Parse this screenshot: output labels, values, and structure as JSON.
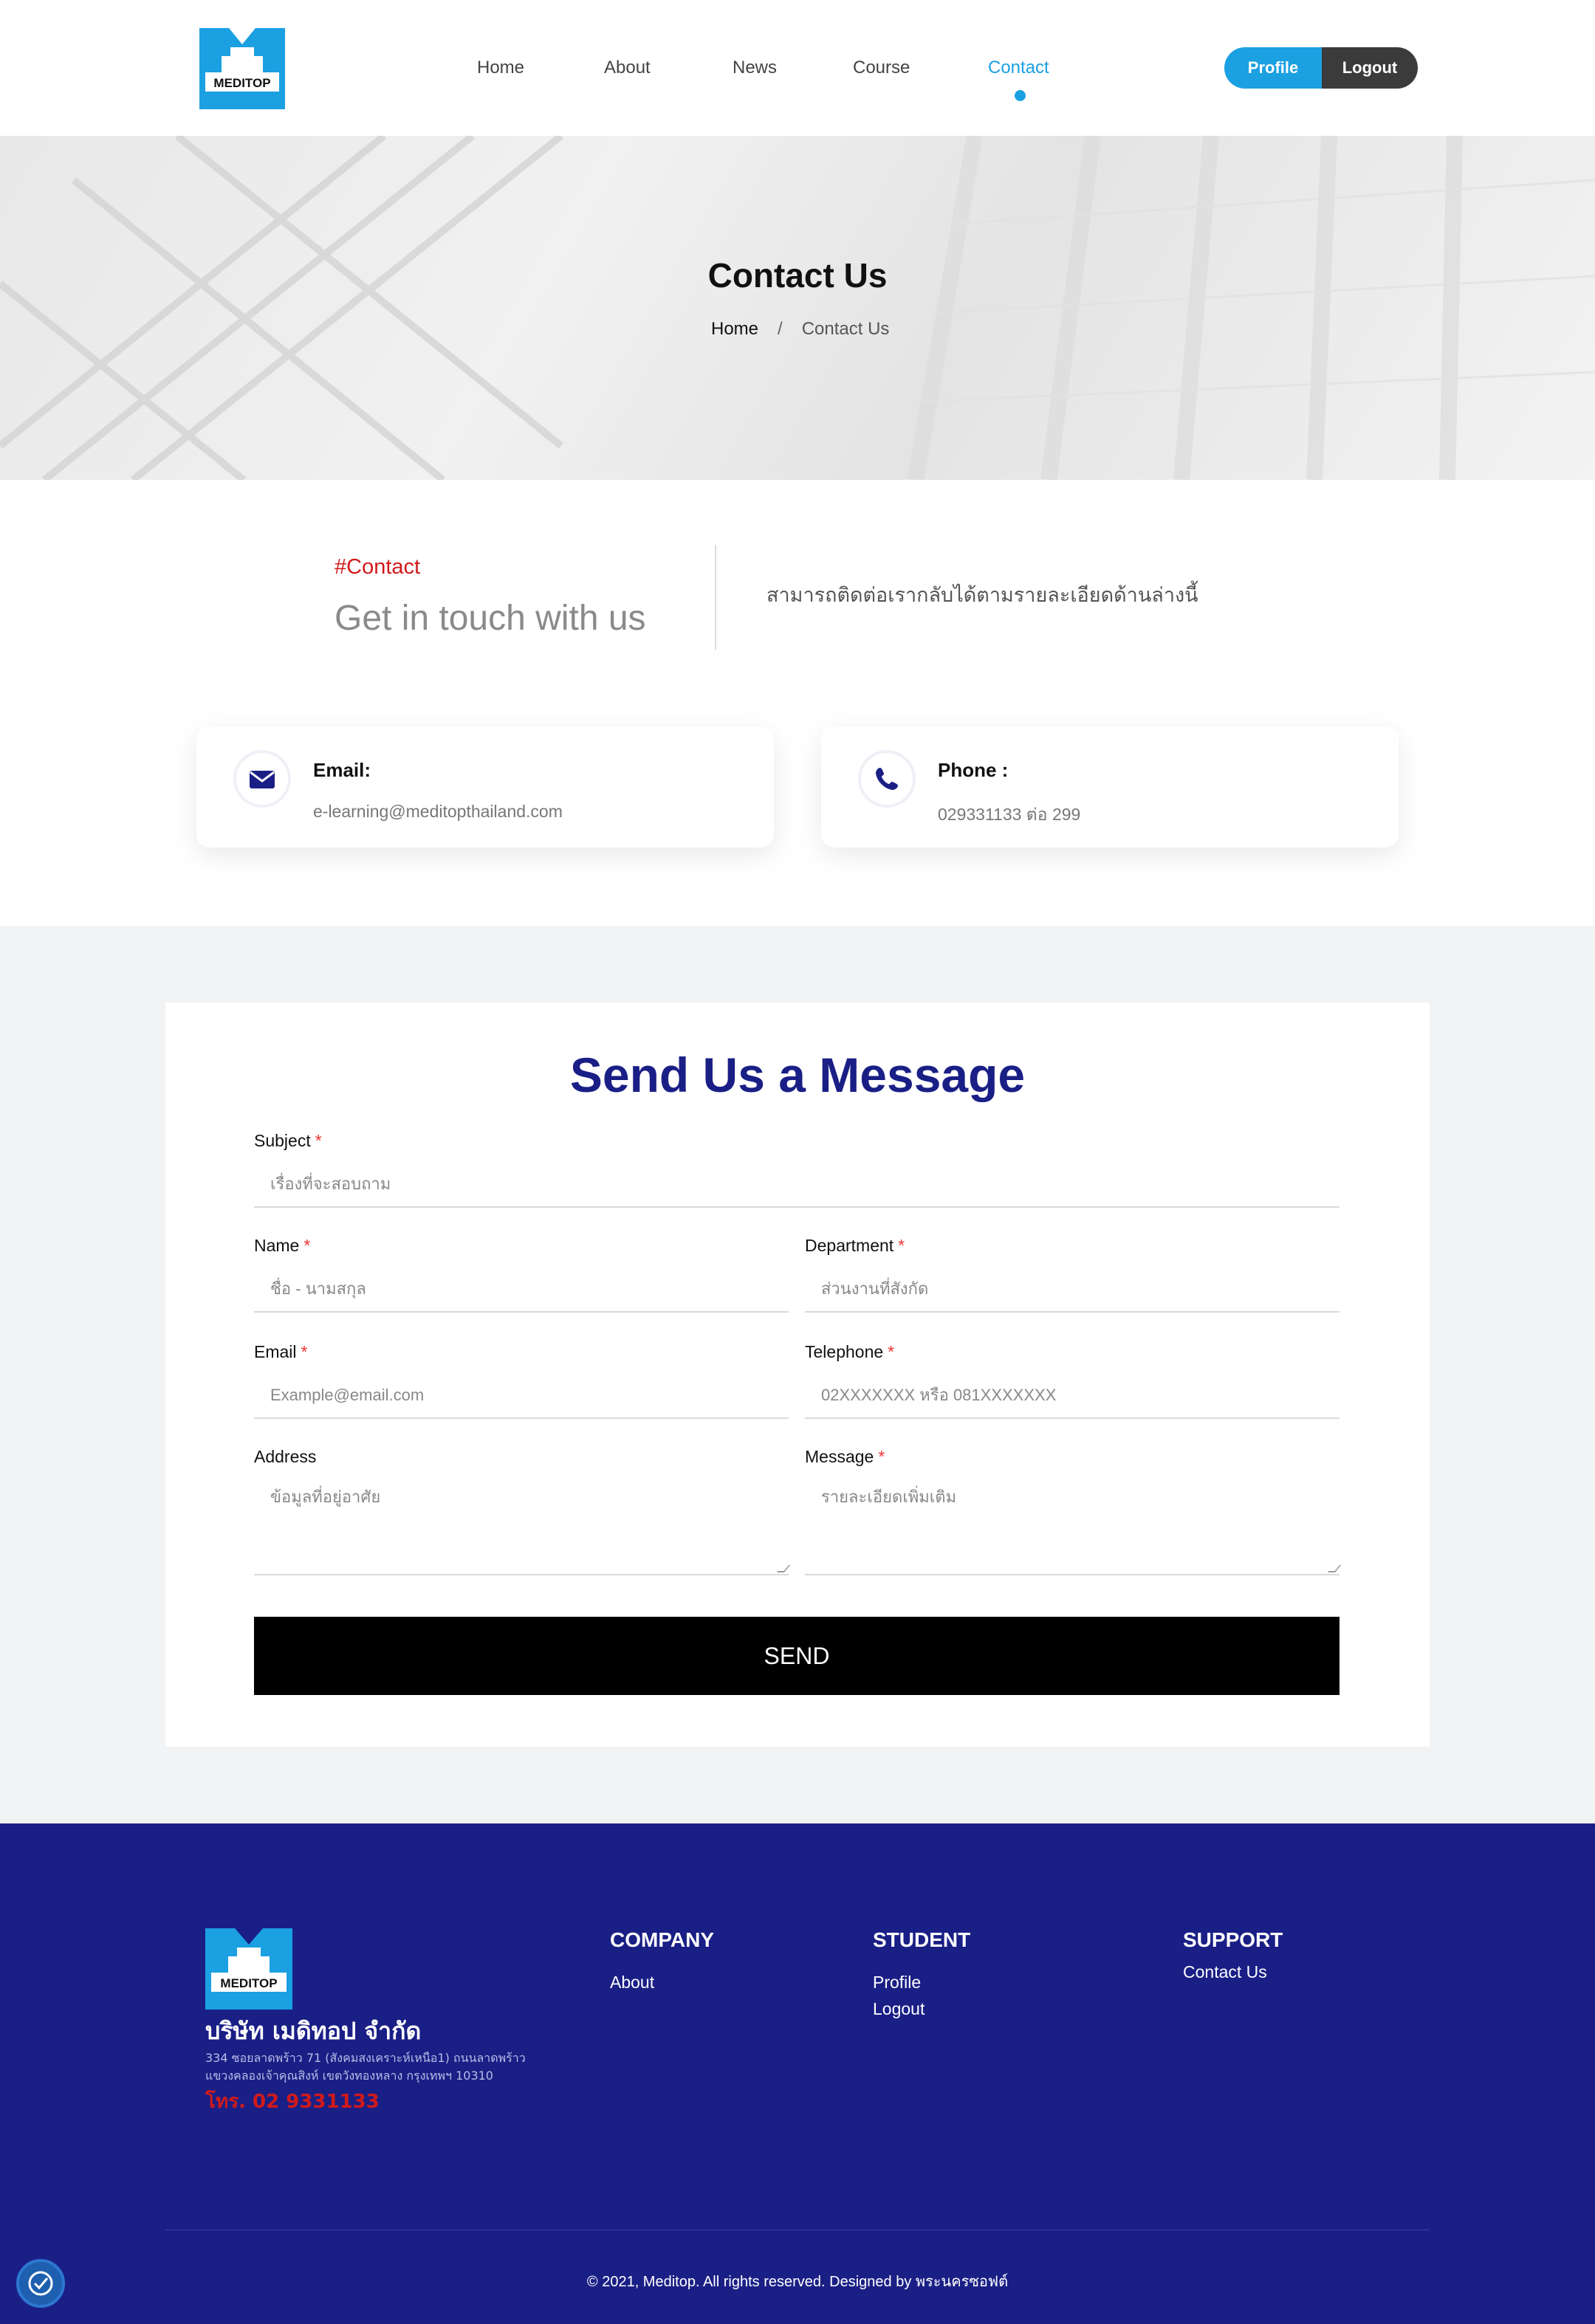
{
  "brand": {
    "logo_text": "MEDITOP",
    "accent": "#1ba0e2",
    "navy": "#1a1f86",
    "red": "#d11a1a"
  },
  "nav": {
    "items": [
      {
        "label": "Home",
        "active": false
      },
      {
        "label": "About",
        "active": false
      },
      {
        "label": "News",
        "active": false
      },
      {
        "label": "Course",
        "active": false
      },
      {
        "label": "Contact",
        "active": true
      }
    ],
    "profile_label": "Profile",
    "logout_label": "Logout"
  },
  "hero": {
    "title": "Contact Us",
    "breadcrumb": {
      "home": "Home",
      "separator": "/",
      "current": "Contact Us"
    }
  },
  "intro": {
    "tag": "#Contact",
    "heading": "Get in touch with us",
    "text": "สามารถติดต่อเรากลับได้ตามรายละเอียดด้านล่างนี้"
  },
  "cards": {
    "email": {
      "icon": "envelope-icon",
      "label": "Email:",
      "value": "e-learning@meditopthailand.com"
    },
    "phone": {
      "icon": "phone-icon",
      "label": "Phone :",
      "value": "029331133 ต่อ 299"
    }
  },
  "form": {
    "title": "Send Us a Message",
    "required_mark": "*",
    "subject": {
      "label": "Subject",
      "placeholder": "เรื่องที่จะสอบถาม",
      "value": ""
    },
    "name": {
      "label": "Name",
      "placeholder": "ชื่อ - นามสกุล",
      "value": ""
    },
    "department": {
      "label": "Department",
      "placeholder": "ส่วนงานที่สังกัด",
      "value": ""
    },
    "email": {
      "label": "Email",
      "placeholder": "Example@email.com",
      "value": ""
    },
    "telephone": {
      "label": "Telephone",
      "placeholder": "02XXXXXXX หรือ 081XXXXXXX",
      "value": ""
    },
    "address": {
      "label": "Address",
      "placeholder": "ข้อมูลที่อยู่อาศัย",
      "value": ""
    },
    "message": {
      "label": "Message",
      "placeholder": "รายละเอียดเพิ่มเติม",
      "value": ""
    },
    "send_label": "SEND"
  },
  "footer": {
    "company_name": "บริษัท เมดิทอป จำกัด",
    "address_line1": "334 ซอยลาดพร้าว 71 (สังคมสงเคราะห์เหนือ1) ถนนลาดพร้าว",
    "address_line2": "แขวงคลองเจ้าคุณสิงห์ เขตวังทองหลาง กรุงเทพฯ 10310",
    "tel": "โทร. 02 9331133",
    "company": {
      "heading": "COMPANY",
      "links": [
        "About"
      ]
    },
    "student": {
      "heading": "STUDENT",
      "links": [
        "Profile",
        "Logout"
      ]
    },
    "support": {
      "heading": "SUPPORT",
      "links": [
        "Contact Us"
      ]
    },
    "copyright": "© 2021, Meditop. All rights reserved. Designed by พระนครซอฟต์"
  }
}
